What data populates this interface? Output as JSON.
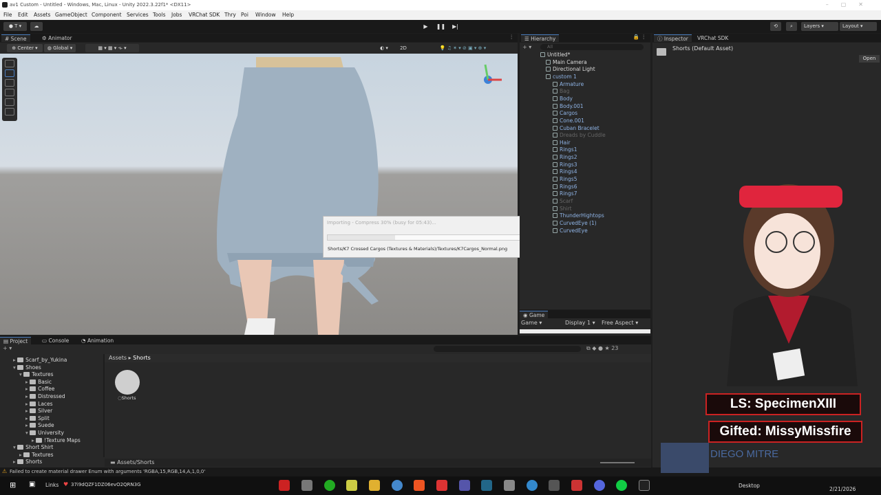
{
  "window": {
    "title": "av1 Custom - Untitled - Windows, Mac, Linux - Unity 2022.3.22f1* <DX11>"
  },
  "menu": [
    "File",
    "Edit",
    "Assets",
    "GameObject",
    "Component",
    "Services",
    "Tools",
    "Jobs",
    "VRChat SDK",
    "Thry",
    "Poi",
    "Window",
    "Help"
  ],
  "toolbar": {
    "layers": "Layers",
    "layout": "Layout"
  },
  "scene": {
    "tabs": [
      "Scene",
      "Animator"
    ],
    "pivot": "Center",
    "space": "Global",
    "mode_2d": "2D"
  },
  "hierarchy": {
    "tab": "Hierarchy",
    "search_placeholder": "All",
    "items": [
      {
        "label": "Untitled*",
        "type": "scene"
      },
      {
        "label": "Main Camera",
        "type": "normal"
      },
      {
        "label": "Directional Light",
        "type": "normal"
      },
      {
        "label": "custom 1",
        "type": "prefab"
      },
      {
        "label": "Armature",
        "type": "prefab"
      },
      {
        "label": "Bag",
        "type": "dim"
      },
      {
        "label": "Body",
        "type": "prefab"
      },
      {
        "label": "Body.001",
        "type": "prefab"
      },
      {
        "label": "Cargos",
        "type": "prefab"
      },
      {
        "label": "Cone.001",
        "type": "prefab"
      },
      {
        "label": "Cuban Bracelet",
        "type": "prefab"
      },
      {
        "label": "Dreads by Cuddle",
        "type": "dim"
      },
      {
        "label": "Hair",
        "type": "prefab"
      },
      {
        "label": "Rings1",
        "type": "prefab"
      },
      {
        "label": "Rings2",
        "type": "prefab"
      },
      {
        "label": "Rings3",
        "type": "prefab"
      },
      {
        "label": "Rings4",
        "type": "prefab"
      },
      {
        "label": "Rings5",
        "type": "prefab"
      },
      {
        "label": "Rings6",
        "type": "prefab"
      },
      {
        "label": "Rings7",
        "type": "prefab"
      },
      {
        "label": "Scarf",
        "type": "dim"
      },
      {
        "label": "Shirt",
        "type": "dim"
      },
      {
        "label": "ThunderHightops",
        "type": "prefab"
      },
      {
        "label": "CurvedEye (1)",
        "type": "prefab"
      },
      {
        "label": "CurvedEye",
        "type": "prefab"
      }
    ]
  },
  "inspector": {
    "tabs": [
      "Inspector",
      "VRChat SDK"
    ],
    "asset_title": "Shorts (Default Asset)",
    "open_button": "Open"
  },
  "game": {
    "tab": "Game",
    "view": "Game",
    "display": "Display 1",
    "aspect": "Free Aspect"
  },
  "progress_dialog": {
    "title": "Importing - Compress 30% (busy for 05:43)...",
    "path": "Shorts/K7 Crossed Cargos (Textures & Materials)/Textures/K7Cargos_Normal.png",
    "progress_percent": 30
  },
  "project": {
    "tabs": [
      "Project",
      "Console",
      "Animation"
    ],
    "breadcrumb": [
      "Assets",
      "Shorts"
    ],
    "hidden_count": "23",
    "bottom_path": "Assets/Shorts",
    "asset": {
      "name": "Shorts"
    },
    "tree": [
      {
        "label": "Scarf_by_Yukina",
        "depth": 1,
        "expanded": false
      },
      {
        "label": "Shoes",
        "depth": 1,
        "expanded": true
      },
      {
        "label": "Textures",
        "depth": 2,
        "expanded": true
      },
      {
        "label": "Basic",
        "depth": 3,
        "expanded": false
      },
      {
        "label": "Coffee",
        "depth": 3,
        "expanded": false
      },
      {
        "label": "Distressed",
        "depth": 3,
        "expanded": false
      },
      {
        "label": "Laces",
        "depth": 3,
        "expanded": false
      },
      {
        "label": "Silver",
        "depth": 3,
        "expanded": false
      },
      {
        "label": "Split",
        "depth": 3,
        "expanded": false
      },
      {
        "label": "Suede",
        "depth": 3,
        "expanded": false
      },
      {
        "label": "University",
        "depth": 3,
        "expanded": true
      },
      {
        "label": "!Texture Maps",
        "depth": 4,
        "expanded": false
      },
      {
        "label": "Short Shirt",
        "depth": 1,
        "expanded": true
      },
      {
        "label": "Textures",
        "depth": 2,
        "expanded": false
      },
      {
        "label": "Shorts",
        "depth": 1,
        "expanded": false
      }
    ]
  },
  "status": {
    "message": "Failed to create material drawer Enum with arguments 'RGBA,15,RGB,14,A,1,0,0'"
  },
  "overlay": {
    "ls": "LS: SpecimenXIII",
    "gifted": "Gifted: MissyMissfire",
    "cam_name": "DIEGO MITRE"
  },
  "taskbar": {
    "links": "Links",
    "code": "37i9dQZF1DZ06evO2QRN3G",
    "desktop": "Desktop",
    "date": "2/21/2026"
  },
  "colors": {
    "accent": "#4c7fc0",
    "prefab": "#8fb4e6",
    "error": "#e0a020",
    "overlay_border": "#cc2222"
  }
}
